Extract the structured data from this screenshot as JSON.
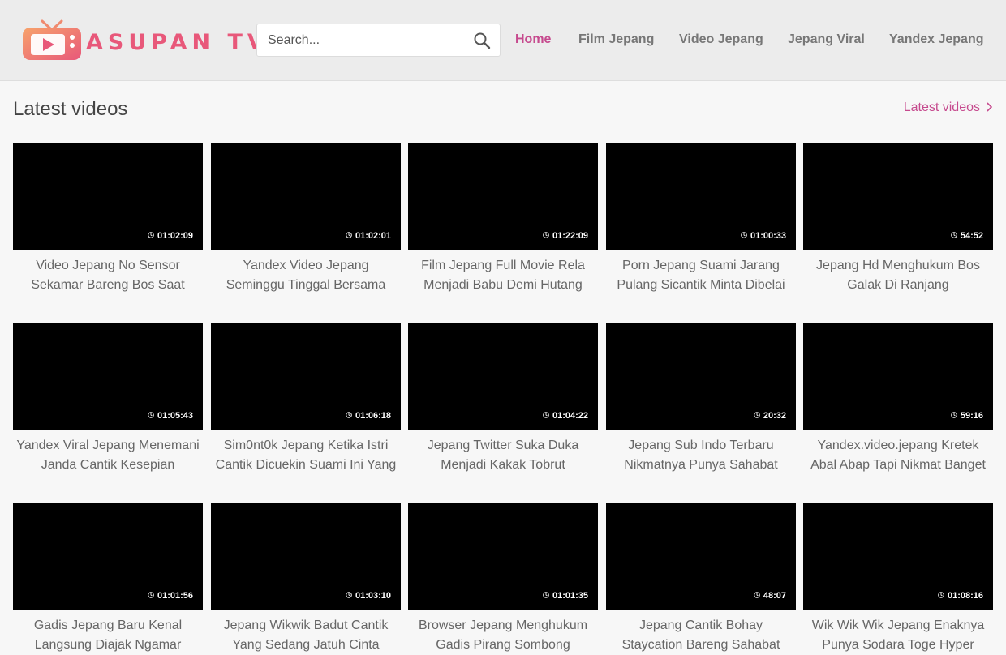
{
  "header": {
    "logo_text": "ASUPAN TV",
    "search_placeholder": "Search...",
    "nav": [
      {
        "label": "Home",
        "active": true
      },
      {
        "label": "Film Jepang",
        "active": false
      },
      {
        "label": "Video Jepang",
        "active": false
      },
      {
        "label": "Jepang Viral",
        "active": false
      },
      {
        "label": "Yandex Jepang",
        "active": false
      }
    ]
  },
  "colors": {
    "accent": "#c64a8e",
    "logo": "#e8587a",
    "thumb": "#000000"
  },
  "section": {
    "title": "Latest videos",
    "link_label": "Latest videos"
  },
  "videos": [
    {
      "duration": "01:02:09",
      "title": "Video Jepang No Sensor Sekamar Bareng Bos Saat Dinas Kerja"
    },
    {
      "duration": "01:02:01",
      "title": "Yandex Video Jepang Seminggu Tinggal Bersama Adik Pacar"
    },
    {
      "duration": "01:22:09",
      "title": "Film Jepang Full Movie Rela Menjadi Babu Demi Hutang"
    },
    {
      "duration": "01:00:33",
      "title": "Porn Jepang Suami Jarang Pulang Sicantik Minta Dibelai"
    },
    {
      "duration": "54:52",
      "title": "Jepang Hd Menghukum Bos Galak Di Ranjang"
    },
    {
      "duration": "01:05:43",
      "title": "Yandex Viral Jepang Menemani Janda Cantik Kesepian"
    },
    {
      "duration": "01:06:18",
      "title": "Sim0nt0k Jepang Ketika Istri Cantik Dicuekin Suami Ini Yang"
    },
    {
      "duration": "01:04:22",
      "title": "Jepang Twitter Suka Duka Menjadi Kakak Tobrut"
    },
    {
      "duration": "20:32",
      "title": "Jepang Sub Indo Terbaru Nikmatnya Punya Sahabat Super"
    },
    {
      "duration": "59:16",
      "title": "Yandex.video.jepang Kretek Abal Abap Tapi Nikmat Banget"
    },
    {
      "duration": "01:01:56",
      "title": "Gadis Jepang Baru Kenal Langsung Diajak Ngamar"
    },
    {
      "duration": "01:03:10",
      "title": "Jepang Wikwik Badut Cantik Yang Sedang Jatuh Cinta"
    },
    {
      "duration": "01:01:35",
      "title": "Browser Jepang Menghukum Gadis Pirang Sombong"
    },
    {
      "duration": "48:07",
      "title": "Jepang Cantik Bohay Staycation Bareng Sahabat Blasteran"
    },
    {
      "duration": "01:08:16",
      "title": "Wik Wik Wik Jepang Enaknya Punya Sodara Toge Hyper"
    }
  ]
}
